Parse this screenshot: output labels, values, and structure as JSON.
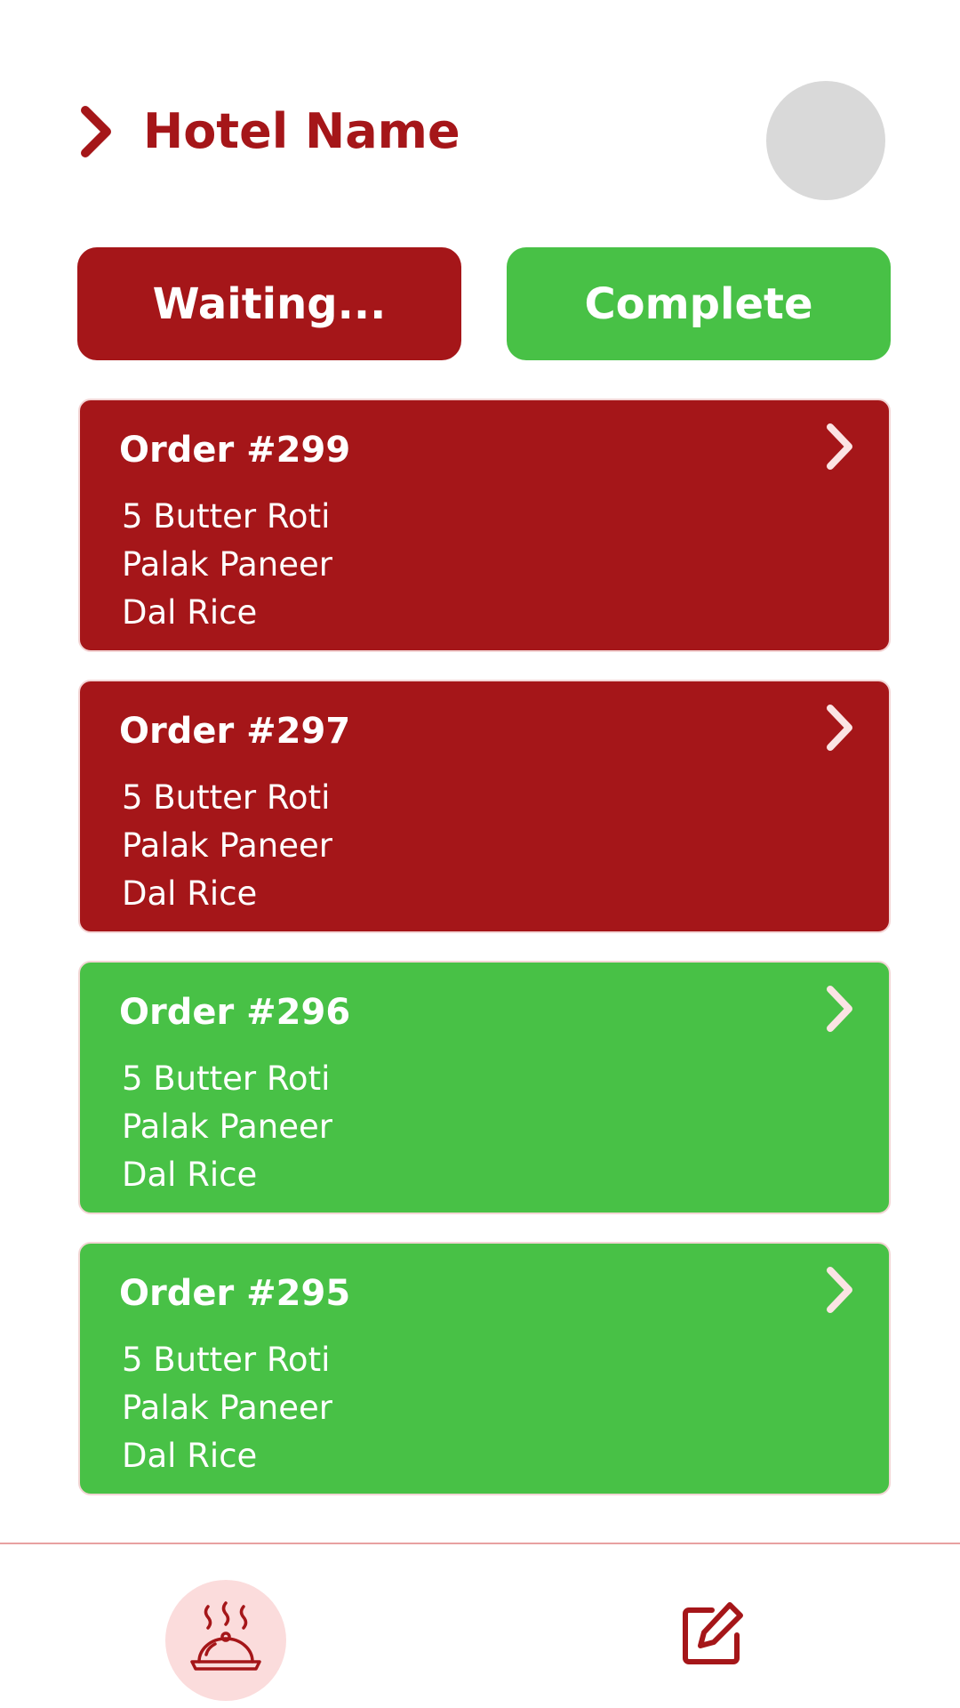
{
  "header": {
    "title": "Hotel Name",
    "back_icon": "chevron-right-icon",
    "avatar": "profile-avatar"
  },
  "filters": {
    "waiting_label": "Waiting...",
    "complete_label": "Complete"
  },
  "orders": [
    {
      "title": "Order #299",
      "status": "waiting",
      "items": [
        "5 Butter Roti",
        "Palak Paneer",
        "Dal Rice"
      ]
    },
    {
      "title": "Order #297",
      "status": "waiting",
      "items": [
        "5 Butter Roti",
        "Palak Paneer",
        "Dal Rice"
      ]
    },
    {
      "title": "Order #296",
      "status": "complete",
      "items": [
        "5 Butter Roti",
        "Palak Paneer",
        "Dal Rice"
      ]
    },
    {
      "title": "Order #295",
      "status": "complete",
      "items": [
        "5 Butter Roti",
        "Palak Paneer",
        "Dal Rice"
      ]
    }
  ],
  "nav": {
    "orders_icon": "food-cloche-icon",
    "edit_icon": "edit-icon"
  },
  "colors": {
    "brand_red": "#a51619",
    "complete_green": "#48c146",
    "avatar_gray": "#d9d9d9",
    "nav_highlight": "#fbdcdc",
    "chevron_light": "#fbe4e4"
  }
}
